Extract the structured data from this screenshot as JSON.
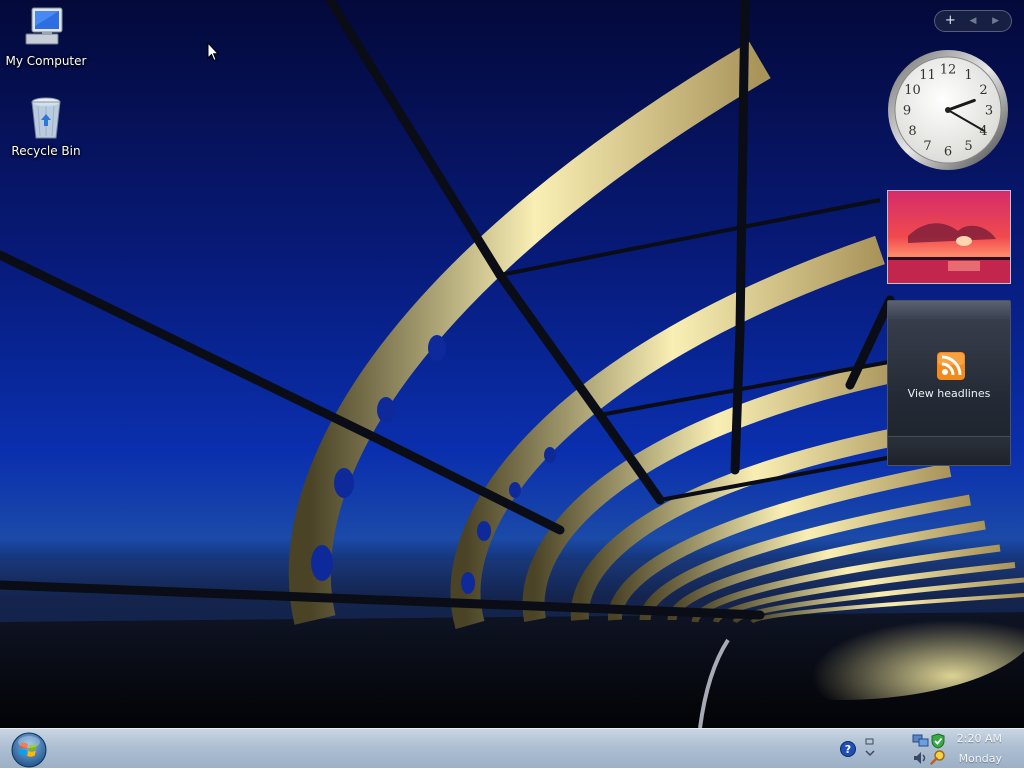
{
  "desktop": {
    "icons": [
      {
        "label": "My Computer",
        "icon": "my-computer-icon"
      },
      {
        "label": "Recycle Bin",
        "icon": "recycle-bin-icon"
      }
    ]
  },
  "sidebar": {
    "controls": {
      "add": "+",
      "prev": "◀",
      "next": "▶"
    },
    "clock": {
      "hour": 2,
      "minute": 20
    },
    "feed": {
      "label": "View headlines",
      "icon": "rss-icon",
      "accent": "#f28a1e"
    },
    "slideshow": {
      "icon": "sunset-photo"
    }
  },
  "taskbar": {
    "start": {
      "icon": "windows-orb-icon"
    },
    "tray": {
      "time": "2:20 AM",
      "day": "Monday",
      "icons": [
        "help-icon",
        "network-icon",
        "shield-icon",
        "volume-icon",
        "search-icon"
      ]
    }
  },
  "colors": {
    "sky_top": "#04093a",
    "sky_mid": "#0a2fae",
    "bridge_glow": "#f6e8a6",
    "taskbar": "#aebfd2"
  }
}
